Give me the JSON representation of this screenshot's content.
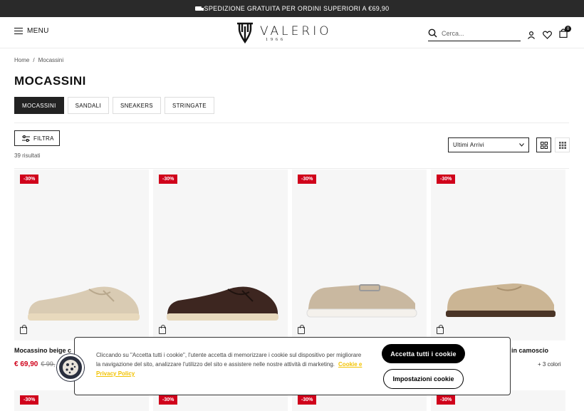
{
  "topbar": {
    "text": "SPEDIZIONE GRATUITA PER ORDINI SUPERIORI A €69,90"
  },
  "header": {
    "menu_label": "MENU",
    "logo_text": "VALERIO",
    "logo_year": "1966",
    "search_placeholder": "Cerca...",
    "cart_count": "0"
  },
  "breadcrumb": {
    "home": "Home",
    "sep": "/",
    "current": "Mocassini"
  },
  "page_title": "MOCASSINI",
  "categories": [
    {
      "label": "MOCASSINI",
      "active": true
    },
    {
      "label": "SANDALI",
      "active": false
    },
    {
      "label": "SNEAKERS",
      "active": false
    },
    {
      "label": "STRINGATE",
      "active": false
    }
  ],
  "toolbar": {
    "filter_label": "FILTRA",
    "results": "39 risultati",
    "sort_value": "Ultimi Arrivi"
  },
  "products": [
    {
      "discount": "-30%",
      "name": "Mocassino beige c",
      "price": "€ 69,90",
      "old_price": "€ 99,",
      "colors": "",
      "shoe_color": "#d9cbb3",
      "sole": "#e8d9bd"
    },
    {
      "discount": "-30%",
      "name": "",
      "price": "",
      "old_price": "",
      "colors": "",
      "shoe_color": "#3d2620",
      "sole": "#e8d9bd"
    },
    {
      "discount": "-30%",
      "name": "",
      "price": "",
      "old_price": "",
      "colors": "",
      "shoe_color": "#c9b8a0",
      "sole": "#f4f1ec"
    },
    {
      "discount": "-30%",
      "name": "in camoscio",
      "price": "",
      "old_price": "",
      "colors": "+ 3 colori",
      "shoe_color": "#cbb594",
      "sole": "#4a3527"
    }
  ],
  "row2_discounts": [
    "-30%",
    "-30%",
    "-30%",
    "-30%"
  ],
  "cookie": {
    "text": "Cliccando su \"Accetta tutti i cookie\", l'utente accetta di memorizzare i cookie sul dispositivo per migliorare la navigazione del sito, analizzare l'utilizzo del sito e assistere nelle nostre attività di marketing.",
    "link": "Cookie e Privacy Policy",
    "accept": "Accetta tutti i cookie",
    "settings": "Impostazioni cookie"
  }
}
